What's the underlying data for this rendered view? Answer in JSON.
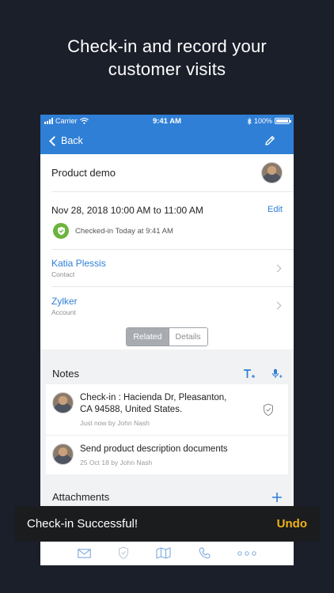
{
  "headline": {
    "line1": "Check-in and record your",
    "line2": "customer visits"
  },
  "status_bar": {
    "carrier": "Carrier",
    "time": "9:41 AM",
    "battery": "100%"
  },
  "nav": {
    "back_label": "Back",
    "edit_icon": "pencil-icon"
  },
  "event": {
    "title": "Product demo",
    "time_range": "Nov 28, 2018 10:00 AM to 11:00 AM",
    "edit_label": "Edit",
    "checkin_status": "Checked-in Today at 9:41 AM"
  },
  "related": [
    {
      "name": "Katia Plessis",
      "type": "Contact"
    },
    {
      "name": "Zylker",
      "type": "Account"
    }
  ],
  "segments": {
    "related": "Related",
    "details": "Details",
    "active": "Related"
  },
  "notes": {
    "title": "Notes",
    "items": [
      {
        "text_line1": "Check-in : Hacienda Dr, Pleasanton,",
        "text_line2": "CA 94588, United States.",
        "meta": "Just now by John Nash",
        "icon": "location-pin-icon"
      },
      {
        "text_line1": "Send product description documents",
        "text_line2": "",
        "meta": "25 Oct 18 by John Nash",
        "icon": ""
      }
    ]
  },
  "attachments": {
    "title": "Attachments"
  },
  "tabbar": [
    "mail-icon",
    "checkin-icon",
    "map-icon",
    "phone-icon",
    "more-icon"
  ],
  "toast": {
    "message": "Check-in Successful!",
    "action": "Undo"
  },
  "colors": {
    "background": "#1b1f2a",
    "brand_blue": "#2f7fd6",
    "checkin_green": "#6cb33f",
    "undo_yellow": "#f2b21b"
  }
}
